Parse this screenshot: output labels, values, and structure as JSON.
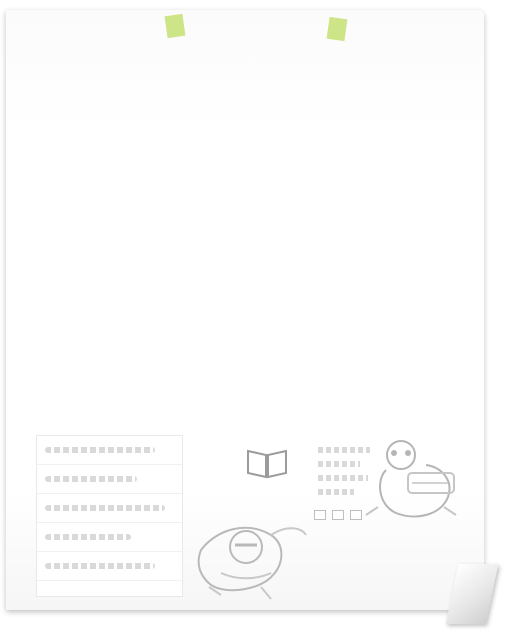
{
  "icons": {
    "tape_left": "tape-icon",
    "tape_right": "tape-icon",
    "book": "open-book-icon",
    "mascot_left": "hero-mascot-illustration",
    "mascot_right": "panda-mascot-illustration"
  },
  "colors": {
    "tape": "#c8e27a",
    "paper": "#ffffff",
    "sketch": "#bfbfbf"
  }
}
